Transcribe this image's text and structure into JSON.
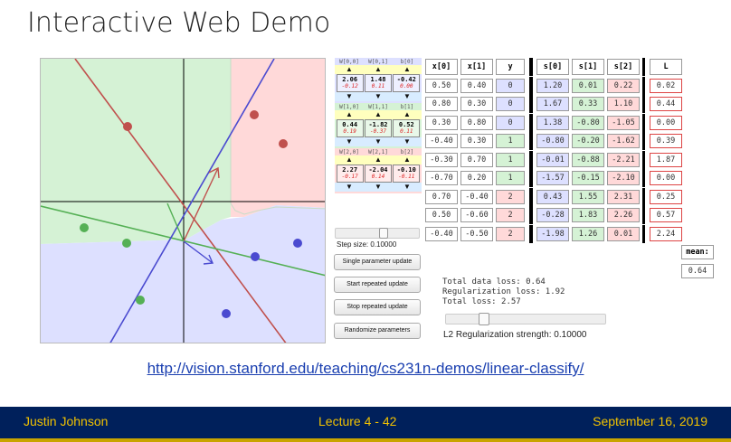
{
  "slide": {
    "title": "Interactive Web Demo",
    "url": "http://vision.stanford.edu/teaching/cs231n-demos/linear-classify/"
  },
  "footer": {
    "author": "Justin Johnson",
    "lecture": "Lecture 4 - 42",
    "date": "September 16, 2019",
    "bg_color": "#00205b",
    "text_color": "#f2c200"
  },
  "colors": {
    "class0": "#dde0ff",
    "class1": "#d5f2d5",
    "class2": "#ffd9d9"
  },
  "weights": {
    "groups": [
      {
        "labels": [
          "W[0,0]",
          "W[0,1]",
          "b[0]"
        ],
        "values": [
          "2.06",
          "1.48",
          "-0.42"
        ],
        "grads": [
          "-0.12",
          "0.11",
          "0.00"
        ]
      },
      {
        "labels": [
          "W[1,0]",
          "W[1,1]",
          "b[1]"
        ],
        "values": [
          "0.44",
          "-1.82",
          "0.52"
        ],
        "grads": [
          "0.19",
          "-0.37",
          "0.11"
        ]
      },
      {
        "labels": [
          "W[2,0]",
          "W[2,1]",
          "b[2]"
        ],
        "values": [
          "2.27",
          "-2.04",
          "-0.10"
        ],
        "grads": [
          "-0.17",
          "0.14",
          "-0.11"
        ]
      }
    ],
    "arrow_up": "▲",
    "arrow_down": "▼"
  },
  "controls": {
    "step_size_label": "Step size: 0.10000",
    "btn_single": "Single parameter update",
    "btn_start": "Start repeated update",
    "btn_stop": "Stop repeated update",
    "btn_randomize": "Randomize parameters",
    "reg_label": "L2 Regularization strength: 0.10000"
  },
  "table": {
    "headers": [
      "x[0]",
      "x[1]",
      "y",
      "s[0]",
      "s[1]",
      "s[2]",
      "L"
    ],
    "rows": [
      {
        "x0": "0.50",
        "x1": "0.40",
        "y": "0",
        "s0": "1.20",
        "s1": "0.01",
        "s2": "0.22",
        "L": "0.02"
      },
      {
        "x0": "0.80",
        "x1": "0.30",
        "y": "0",
        "s0": "1.67",
        "s1": "0.33",
        "s2": "1.10",
        "L": "0.44"
      },
      {
        "x0": "0.30",
        "x1": "0.80",
        "y": "0",
        "s0": "1.38",
        "s1": "-0.80",
        "s2": "-1.05",
        "L": "0.00"
      },
      {
        "x0": "-0.40",
        "x1": "0.30",
        "y": "1",
        "s0": "-0.80",
        "s1": "-0.20",
        "s2": "-1.62",
        "L": "0.39"
      },
      {
        "x0": "-0.30",
        "x1": "0.70",
        "y": "1",
        "s0": "-0.01",
        "s1": "-0.88",
        "s2": "-2.21",
        "L": "1.87"
      },
      {
        "x0": "-0.70",
        "x1": "0.20",
        "y": "1",
        "s0": "-1.57",
        "s1": "-0.15",
        "s2": "-2.10",
        "L": "0.00"
      },
      {
        "x0": "0.70",
        "x1": "-0.40",
        "y": "2",
        "s0": "0.43",
        "s1": "1.55",
        "s2": "2.31",
        "L": "0.25"
      },
      {
        "x0": "0.50",
        "x1": "-0.60",
        "y": "2",
        "s0": "-0.28",
        "s1": "1.83",
        "s2": "2.26",
        "L": "0.57"
      },
      {
        "x0": "-0.40",
        "x1": "-0.50",
        "y": "2",
        "s0": "-1.98",
        "s1": "1.26",
        "s2": "0.01",
        "L": "2.24"
      }
    ],
    "mean_label": "mean:",
    "mean_value": "0.64"
  },
  "loss": {
    "data_loss": "Total data loss: 0.64",
    "reg_loss": "Regularization loss: 1.92",
    "total_loss": "Total loss: 2.57"
  }
}
